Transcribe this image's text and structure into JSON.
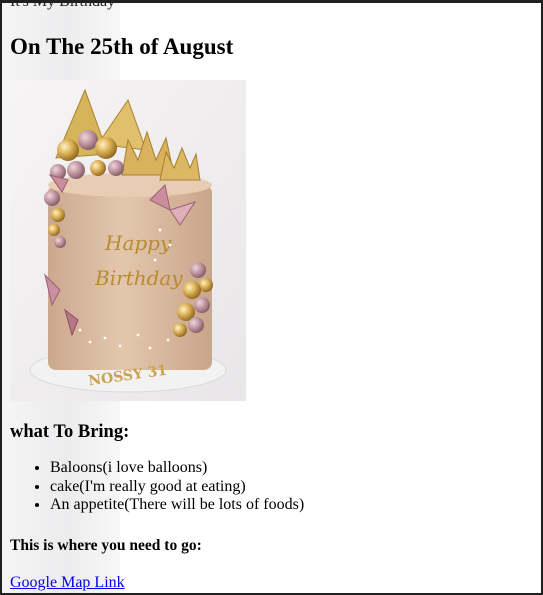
{
  "page": {
    "pre_title": "It's My Birthday",
    "heading": "On The 25th of August"
  },
  "image": {
    "cake_text_top": "Happy",
    "cake_text_bottom": "Birthday",
    "cake_name": "NOSSY 31"
  },
  "bring": {
    "heading": "what To Bring:",
    "items": [
      "Baloons(i love balloons)",
      "cake(I'm really good at eating)",
      "An appetite(There will be lots of foods)"
    ]
  },
  "location": {
    "heading": "This is where you need to go:",
    "link_text": "Google Map Link"
  },
  "colors": {
    "link": "#0000ee",
    "cake_base": "#d8b89c",
    "gold": "#c9a24a",
    "pink": "#c98fa0"
  }
}
